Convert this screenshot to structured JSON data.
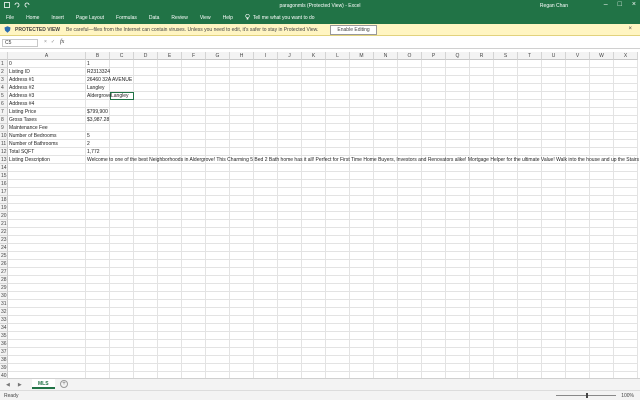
{
  "window": {
    "title": "paragonmls (Protected View) - Excel",
    "user": "Regan Chan"
  },
  "ribbon": {
    "tabs": [
      "File",
      "Home",
      "Insert",
      "Page Layout",
      "Formulas",
      "Data",
      "Review",
      "View",
      "Help"
    ],
    "tell_me": "Tell me what you want to do"
  },
  "protected_view": {
    "label": "PROTECTED VIEW",
    "message": "Be careful—files from the Internet can contain viruses. Unless you need to edit, it's safer to stay in Protected View.",
    "button": "Enable Editing"
  },
  "formula_bar": {
    "name_box": "C5",
    "fx": "fx",
    "content": ""
  },
  "columns": [
    "A",
    "B",
    "C",
    "D",
    "E",
    "F",
    "G",
    "H",
    "I",
    "J",
    "K",
    "L",
    "M",
    "N",
    "O",
    "P",
    "Q",
    "R",
    "S",
    "T",
    "U",
    "V",
    "W",
    "X"
  ],
  "rows": [
    {
      "n": "1",
      "a": "0",
      "b": "1"
    },
    {
      "n": "2",
      "a": "Listing ID",
      "b": "R2313324"
    },
    {
      "n": "3",
      "a": "Address #1",
      "b": "26460 32A AVENUE"
    },
    {
      "n": "4",
      "a": "Address #2",
      "b": "Langley"
    },
    {
      "n": "5",
      "a": "Address #3",
      "b": "Aldergrove",
      "c": "Langley"
    },
    {
      "n": "6",
      "a": "Address #4",
      "b": ""
    },
    {
      "n": "7",
      "a": "Listing Price",
      "b": "$799,900"
    },
    {
      "n": "8",
      "a": "Gross Taxes",
      "b": "$3,987.28"
    },
    {
      "n": "9",
      "a": "Maintenance Fee",
      "b": ""
    },
    {
      "n": "10",
      "a": "Number of Bedrooms",
      "b": "5"
    },
    {
      "n": "11",
      "a": "Number of Bathrooms",
      "b": "2"
    },
    {
      "n": "12",
      "a": "Total SQFT",
      "b": "1,772"
    },
    {
      "n": "13",
      "a": "Listing Description",
      "b": "Welcome to one of the best Neighborhoods in Aldergrove! This Charming 5 Bed 2 Bath home has it all! Perfect for First Time Home Buyers, Investors and Renovators alike! Mortgage Helper for the ultimate Value! Walk into the house and up the Stairs to"
    },
    {
      "n": "14"
    },
    {
      "n": "15"
    },
    {
      "n": "16"
    },
    {
      "n": "17"
    },
    {
      "n": "18"
    },
    {
      "n": "19"
    },
    {
      "n": "20"
    },
    {
      "n": "21"
    },
    {
      "n": "22"
    },
    {
      "n": "23"
    },
    {
      "n": "24"
    },
    {
      "n": "25"
    },
    {
      "n": "26"
    },
    {
      "n": "27"
    },
    {
      "n": "28"
    },
    {
      "n": "29"
    },
    {
      "n": "30"
    },
    {
      "n": "31"
    },
    {
      "n": "32"
    },
    {
      "n": "33"
    },
    {
      "n": "34"
    },
    {
      "n": "35"
    },
    {
      "n": "36"
    },
    {
      "n": "37"
    },
    {
      "n": "38"
    },
    {
      "n": "39"
    },
    {
      "n": "40"
    },
    {
      "n": "41"
    }
  ],
  "sheet_tabs": [
    {
      "label": "MLS",
      "active": true
    }
  ],
  "status": {
    "ready": "Ready",
    "zoom": "100%"
  },
  "colors": {
    "accent": "#217346",
    "protected_bg": "#fff5c2"
  }
}
